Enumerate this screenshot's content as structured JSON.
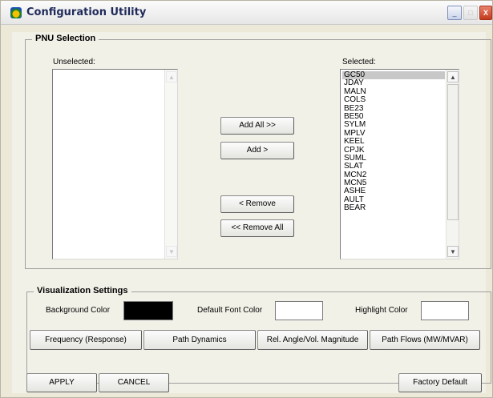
{
  "window": {
    "title": "Configuration Utility"
  },
  "titlebar": {
    "minimize_glyph": "_",
    "maximize_glyph": "□",
    "close_glyph": "X"
  },
  "pnu_selection": {
    "legend": "PNU Selection",
    "unselected_label": "Unselected:",
    "selected_label": "Selected:",
    "unselected_items": [],
    "selected_items": [
      "GC50",
      "JDAY",
      "MALN",
      "COLS",
      "BE23",
      "BE50",
      "SYLM",
      "MPLV",
      "KEEL",
      "CPJK",
      "SUML",
      "SLAT",
      "MCN2",
      "MCN5",
      "ASHE",
      "AULT",
      "BEAR"
    ],
    "selected_index": 0,
    "buttons": {
      "add_all": "Add All >>",
      "add": "Add >",
      "remove": "< Remove",
      "remove_all": "<< Remove All"
    }
  },
  "visualization_settings": {
    "legend": "Visualization Settings",
    "background_color_label": "Background Color",
    "background_color": "#000000",
    "default_font_color_label": "Default Font Color",
    "default_font_color": "#ffffff",
    "highlight_color_label": "Highlight Color",
    "highlight_color": "#ffffff",
    "mode_buttons": [
      "Frequency (Response)",
      "Path Dynamics",
      "Rel. Angle/Vol. Magnitude",
      "Path Flows (MW/MVAR)"
    ]
  },
  "footer": {
    "apply": "APPLY",
    "cancel": "CANCEL",
    "factory_default": "Factory Default"
  },
  "scroll": {
    "up_glyph": "▲",
    "down_glyph": "▼"
  },
  "icons": {
    "app": "app-logo-icon"
  }
}
